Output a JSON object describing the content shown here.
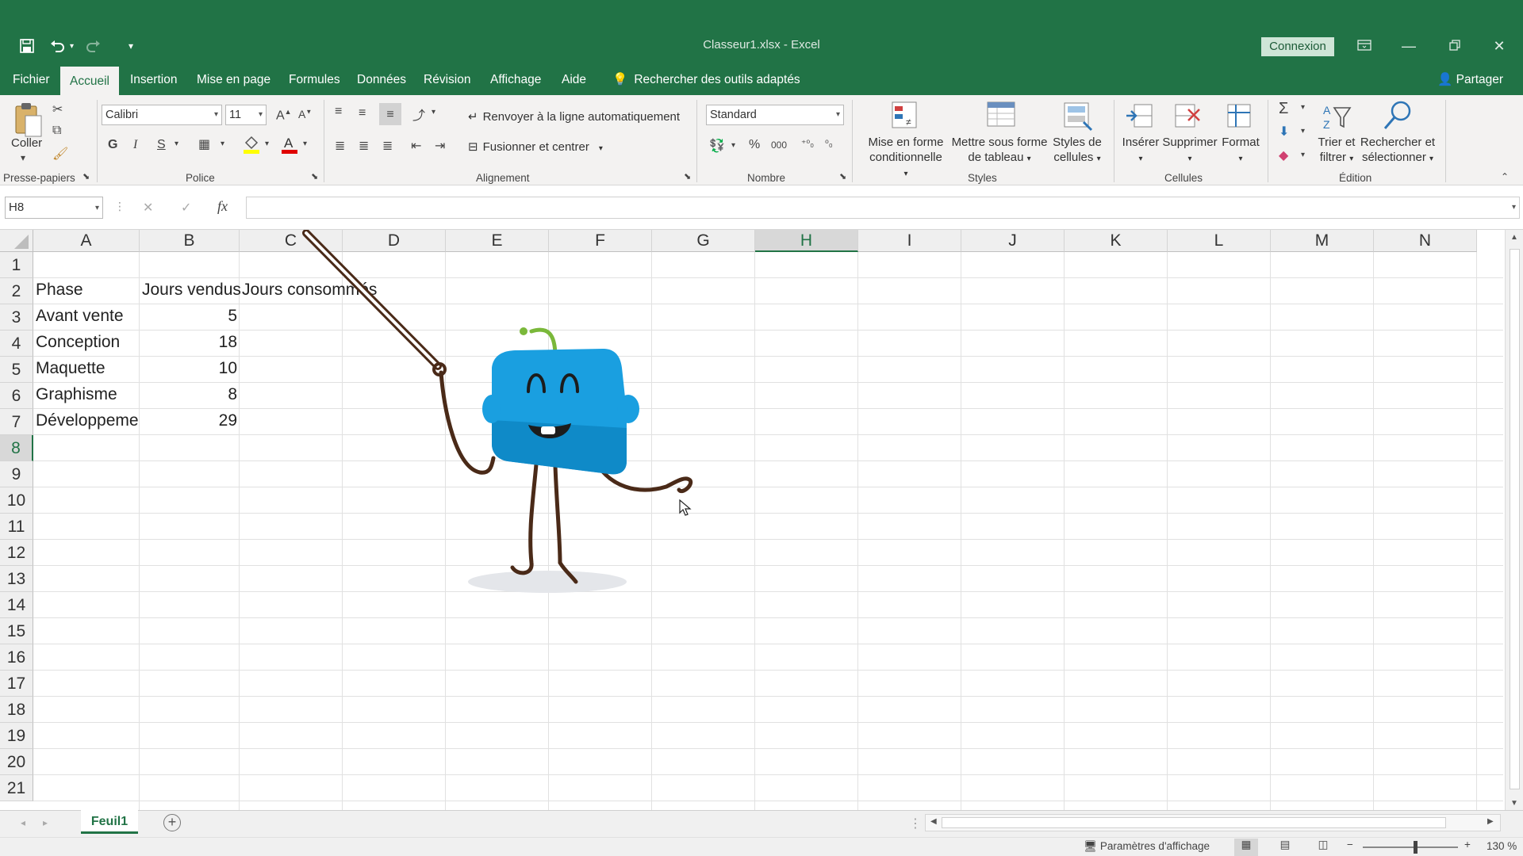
{
  "window": {
    "title": "Classeur1.xlsx  -  Excel",
    "signin_label": "Connexion"
  },
  "tabs": [
    "Fichier",
    "Accueil",
    "Insertion",
    "Mise en page",
    "Formules",
    "Données",
    "Révision",
    "Affichage",
    "Aide"
  ],
  "active_tab": "Accueil",
  "tell_me": "Rechercher des outils adaptés",
  "share_label": "Partager",
  "ribbon": {
    "clipboard": {
      "paste_label": "Coller",
      "group_label": "Presse-papiers"
    },
    "font": {
      "font_name": "Calibri",
      "font_size": "11",
      "bold": "G",
      "italic": "I",
      "underline": "S",
      "group_label": "Police"
    },
    "alignment": {
      "wrap_text": "Renvoyer à la ligne automatiquement",
      "merge_center": "Fusionner et centrer",
      "group_label": "Alignement"
    },
    "number": {
      "format": "Standard",
      "percent": "%",
      "thousands": "000",
      "group_label": "Nombre"
    },
    "styles": {
      "conditional_1": "Mise en forme",
      "conditional_2": "conditionnelle",
      "table_1": "Mettre sous forme",
      "table_2": "de tableau",
      "cell_1": "Styles de",
      "cell_2": "cellules",
      "group_label": "Styles"
    },
    "cells": {
      "insert": "Insérer",
      "delete": "Supprimer",
      "format": "Format",
      "group_label": "Cellules"
    },
    "editing": {
      "sort_1": "Trier et",
      "sort_2": "filtrer",
      "find_1": "Rechercher et",
      "find_2": "sélectionner",
      "group_label": "Édition"
    }
  },
  "formula_bar": {
    "name_box": "H8",
    "fx": "fx",
    "value": ""
  },
  "columns": [
    "A",
    "B",
    "C",
    "D",
    "E",
    "F",
    "G",
    "H",
    "I",
    "J",
    "K",
    "L",
    "M",
    "N"
  ],
  "rows": [
    "1",
    "2",
    "3",
    "4",
    "5",
    "6",
    "7",
    "8",
    "9",
    "10",
    "11",
    "12",
    "13",
    "14",
    "15",
    "16",
    "17",
    "18",
    "19",
    "20",
    "21"
  ],
  "cells": {
    "A2": "Phase",
    "B2": "Jours vendus",
    "C2": "Jours consommés",
    "A3": "Avant vente",
    "B3": "5",
    "A4": "Conception",
    "B4": "18",
    "A5": "Maquette",
    "B5": "10",
    "A6": "Graphisme",
    "B6": "8",
    "A7": "Développement",
    "B7": "29"
  },
  "sheet_tab": "Feuil1",
  "status": {
    "display_settings": "Paramètres d'affichage",
    "zoom": "130 %"
  },
  "colors": {
    "excel_green": "#217346",
    "mascot_blue": "#1a9fe0",
    "mascot_limb": "#4a2a18"
  }
}
